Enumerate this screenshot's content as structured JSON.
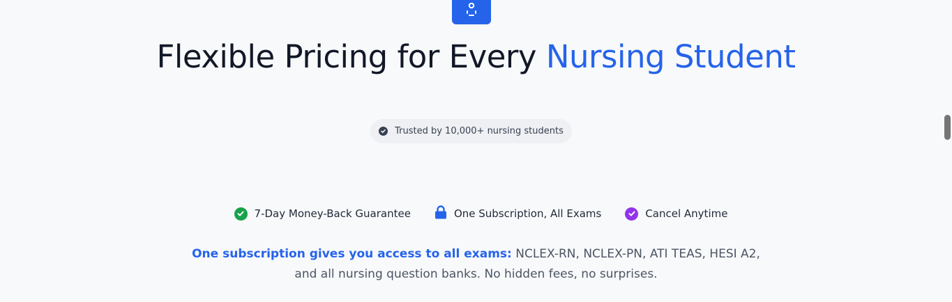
{
  "headline": {
    "part1": "Flexible Pricing for Every ",
    "accent": "Nursing Student"
  },
  "trust_badge": {
    "text": "Trusted by 10,000+ nursing students",
    "icon": "check-circle-icon"
  },
  "features": [
    {
      "label": "7-Day Money-Back Guarantee",
      "icon": "green-check-icon",
      "color": "#16a34a"
    },
    {
      "label": "One Subscription, All Exams",
      "icon": "lock-icon",
      "color": "#2563eb"
    },
    {
      "label": "Cancel Anytime",
      "icon": "purple-check-icon",
      "color": "#9333ea"
    }
  ],
  "description": {
    "lead": "One subscription gives you access to all exams:",
    "line1_rest": " NCLEX-RN, NCLEX-PN, ATI TEAS, HESI A2,",
    "line2": "and all nursing question banks. No hidden fees, no surprises."
  },
  "colors": {
    "accent": "#2563eb",
    "background": "#f8f9fb",
    "heading": "#111827"
  },
  "logo": {
    "icon": "stethoscope-icon"
  }
}
